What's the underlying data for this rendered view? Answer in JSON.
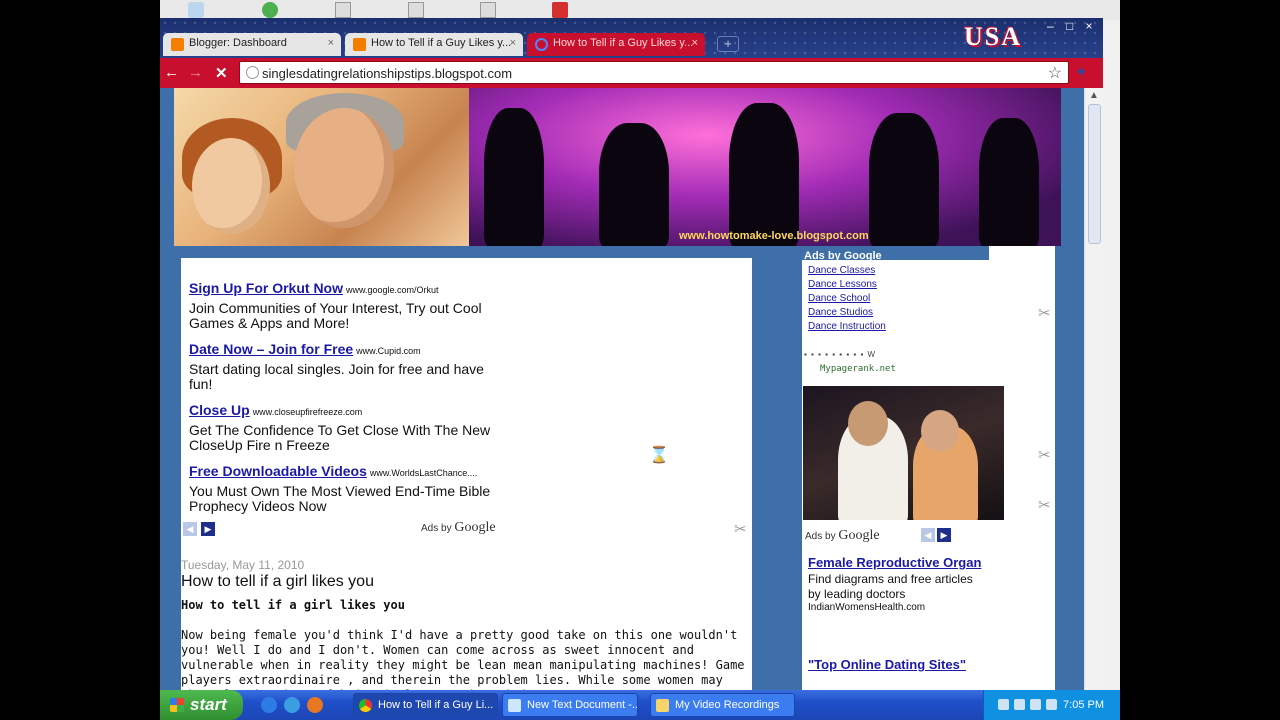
{
  "browser": {
    "tabs": [
      {
        "label": "Blogger: Dashboard",
        "close": "×"
      },
      {
        "label": "How to Tell if a Guy Likes y...",
        "close": "×"
      },
      {
        "label": "How to Tell if a Guy Likes y...",
        "close": "×"
      }
    ],
    "new_tab": "+",
    "theme_text": "USA",
    "window_buttons": {
      "minimize": "–",
      "maximize": "□",
      "close": "×"
    },
    "nav": {
      "back": "←",
      "forward": "→",
      "stop": "✕"
    },
    "url": "singlesdatingrelationshipstips.blogspot.com",
    "star": "☆",
    "wrench": "🔧",
    "scroll_up": "▲"
  },
  "banner": {
    "url": "www.howtomake-love.blogspot.com"
  },
  "ads": [
    {
      "title": "Sign Up For Orkut Now",
      "domain": "www.google.com/Orkut",
      "desc": "Join Communities of Your Interest, Try out Cool Games & Apps and More!"
    },
    {
      "title": "Date Now – Join for Free",
      "domain": "www.Cupid.com",
      "desc": "Start dating local singles. Join for free and have fun!"
    },
    {
      "title": "Close Up",
      "domain": "www.closeupfirefreeze.com",
      "desc": "Get The Confidence To Get Close With The New CloseUp Fire n Freeze"
    },
    {
      "title": "Free Downloadable Videos",
      "domain": "www.WorldsLastChance....",
      "desc": "You Must Own The Most Viewed End-Time Bible Prophecy Videos Now"
    }
  ],
  "ads_by": {
    "prefix": "Ads by",
    "brand": "Google",
    "prev": "◀",
    "next": "▶"
  },
  "post": {
    "date": "Tuesday, May 11, 2010",
    "title": "How to tell if a girl likes you",
    "subtitle": "How to tell if a girl likes you",
    "body": "Now being female you'd think I'd have a pretty good take on this one wouldn't you! Well I do and I don't. Women can come across as sweet innocent and vulnerable when in reality they might be lean mean manipulating machines! Game players extraordinaire , and therein the problem lies. While some women may show classic signs of being in love, such as being"
  },
  "sidebar": {
    "ads_header": "Ads by Google",
    "links": [
      "Dance Classes",
      "Dance Lessons",
      "Dance School",
      "Dance Studios",
      "Dance Instruction"
    ],
    "socials": "▪ ▪ ▪ ▪ ▪ ▪ ▪ ▪ ▪ W",
    "mypagerank": "Mypagerank.net",
    "ad1": {
      "title": "Female Reproductive Organ",
      "desc": "Find diagrams and free articles by leading doctors",
      "domain": "IndianWomensHealth.com"
    },
    "ad2": {
      "title": "\"Top Online Dating Sites\""
    }
  },
  "scissor_glyph": "✂",
  "cursor": "⌛",
  "taskbar": {
    "start": "start",
    "items": [
      {
        "label": "How to Tell if a Guy Li..."
      },
      {
        "label": "New Text Document -..."
      },
      {
        "label": "My Video Recordings"
      }
    ],
    "clock": "7:05 PM"
  }
}
